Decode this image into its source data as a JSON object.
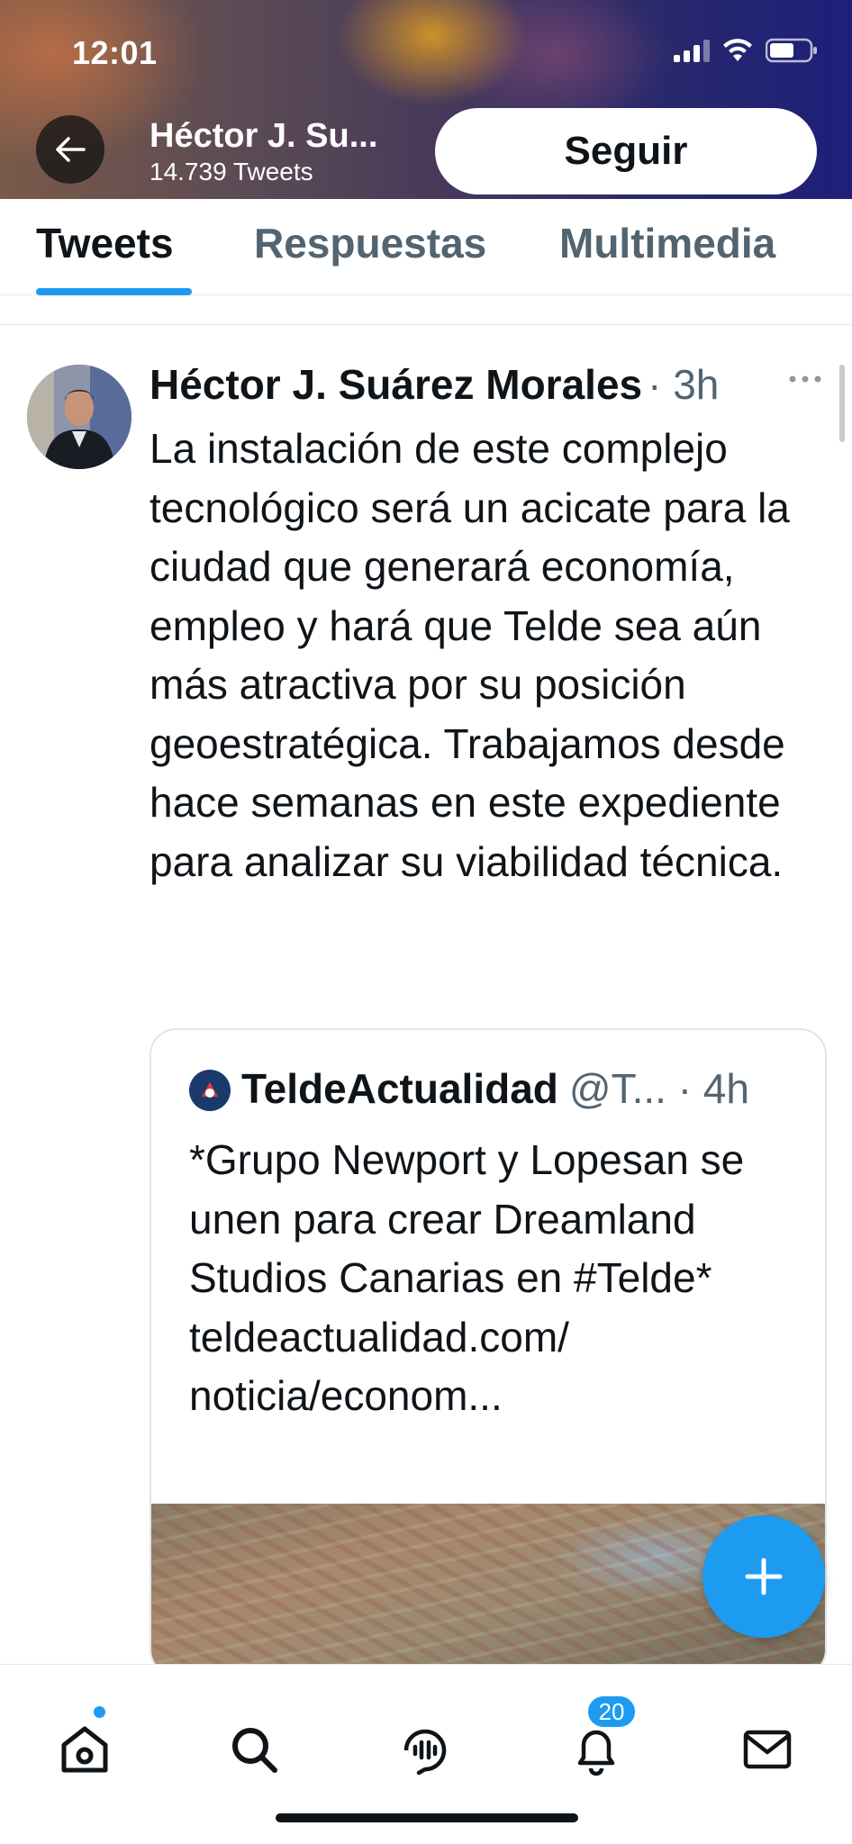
{
  "status_bar": {
    "time": "12:01"
  },
  "header": {
    "name": "Héctor J. Su...",
    "tweet_count": "14.739 Tweets",
    "follow_label": "Seguir"
  },
  "tabs": [
    {
      "label": "Tweets",
      "active": true
    },
    {
      "label": "Respuestas",
      "active": false
    },
    {
      "label": "Multimedia",
      "active": false
    }
  ],
  "tweet": {
    "author": "Héctor J. Suárez Morales",
    "meta": "· 3h",
    "text": "La instalación de este complejo tecnológico será un acicate para la ciudad que generará economía, empleo y hará que Telde sea aún más atractiva por su posición geoestratégica. Trabajamos desde hace semanas en este expediente para analizar su viabilidad técnica.",
    "quote": {
      "author": "TeldeActualidad",
      "meta": "@T... · 4h",
      "text": "*Grupo Newport y Lopesan se unen para crear Dreamland Studios Canarias en #Telde* teldeactualidad.com/ noticia/econom..."
    }
  },
  "bottom_nav": {
    "notifications_badge": "20"
  },
  "colors": {
    "accent": "#1d9bf0",
    "text_primary": "#0f1419",
    "text_secondary": "#536471"
  }
}
